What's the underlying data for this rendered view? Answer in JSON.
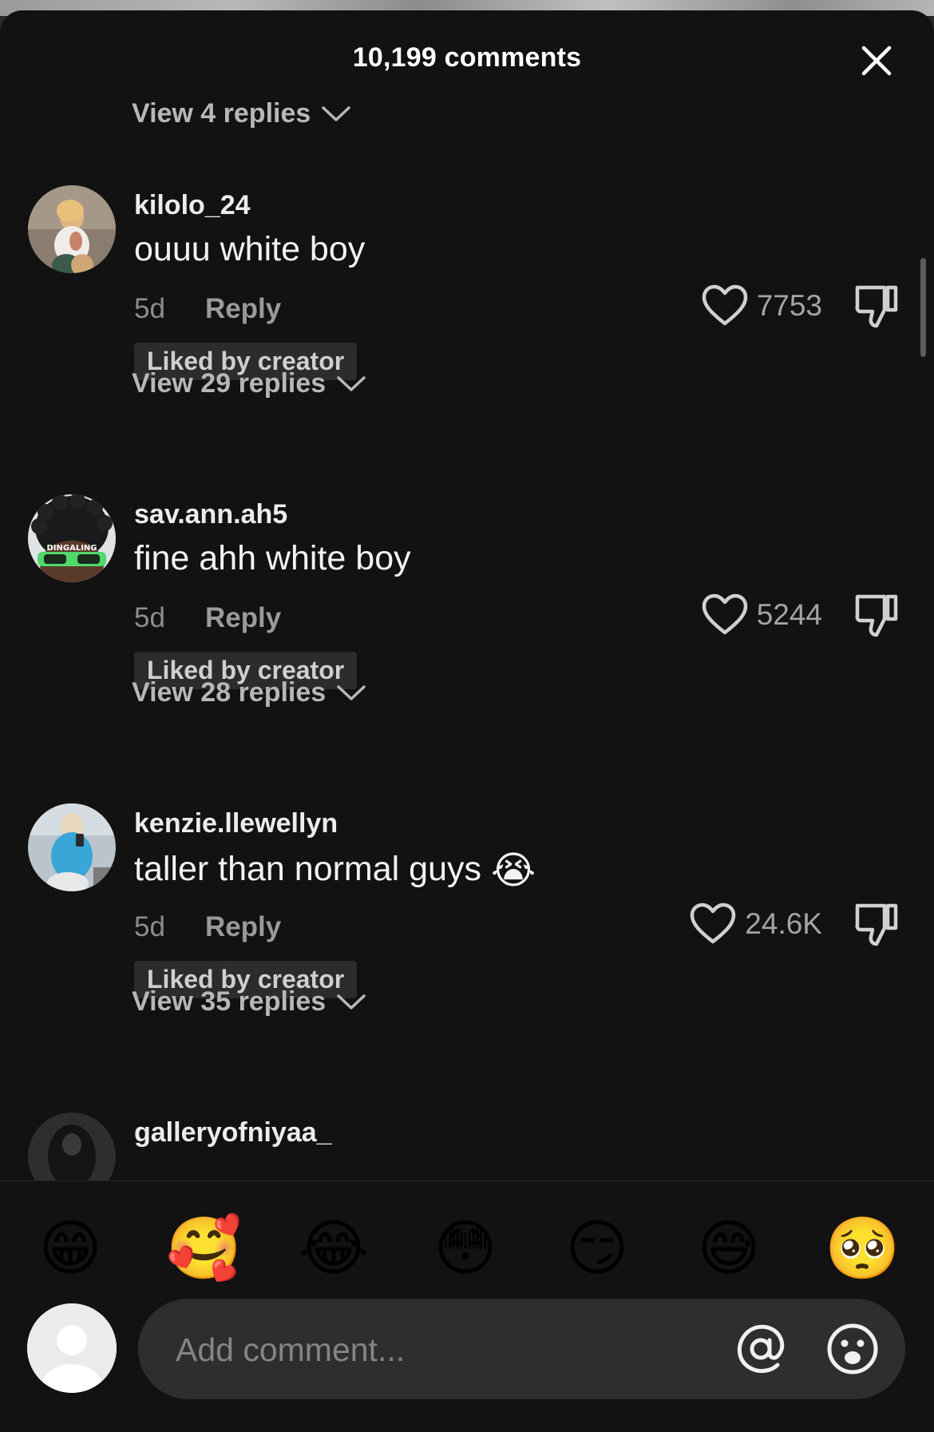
{
  "header": {
    "title": "10,199 comments"
  },
  "top_replies": {
    "label": "View 4 replies"
  },
  "comments": [
    {
      "username": "kilolo_24",
      "text": "ouuu white boy",
      "emoji": "",
      "age": "5d",
      "reply_label": "Reply",
      "badge": "Liked by creator",
      "likes": "7753",
      "view_replies": "View 29 replies"
    },
    {
      "username": "sav.ann.ah5",
      "text": "fine ahh white boy",
      "emoji": "",
      "age": "5d",
      "reply_label": "Reply",
      "badge": "Liked by creator",
      "likes": "5244",
      "view_replies": "View 28 replies",
      "avatar_text": "DINGALING"
    },
    {
      "username": "kenzie.llewellyn",
      "text": "taller than normal guys",
      "emoji": "😭",
      "age": "5d",
      "reply_label": "Reply",
      "badge": "Liked by creator",
      "likes": "24.6K",
      "view_replies": "View 35 replies"
    },
    {
      "username": "galleryofniyaa_"
    }
  ],
  "emoji_bar": [
    "😁",
    "🥰",
    "😂",
    "😳",
    "😏",
    "😅",
    "🥺"
  ],
  "input": {
    "placeholder": "Add comment..."
  },
  "colors": {
    "background": "#121212",
    "text_primary": "#f2f2f2",
    "text_secondary": "#8d8d8d",
    "badge_bg": "#2c2c2c",
    "input_bg": "#2e2e2e"
  }
}
